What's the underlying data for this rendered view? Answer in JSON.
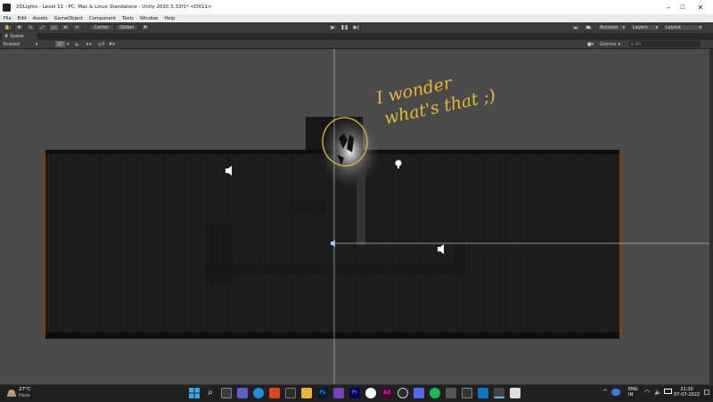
{
  "window": {
    "title": "2DLights - Level 11 - PC, Mac & Linux Standalone - Unity 2020.3.33f1* <DX11>",
    "controls": [
      "–",
      "☐",
      "✕"
    ]
  },
  "menu": [
    "File",
    "Edit",
    "Assets",
    "GameObject",
    "Component",
    "Tools",
    "Window",
    "Help"
  ],
  "toolbar": {
    "pivot_label": "Center",
    "space_label": "Global",
    "account_label": "Account",
    "layers_label": "Layers",
    "layout_label": "Layout"
  },
  "scene": {
    "tab_label": "Scene",
    "shading_mode": "Shaded",
    "view_mode_label": "2D",
    "gizmos_label": "Gizmos",
    "search_placeholder": "All"
  },
  "annotation": {
    "line1": "I wonder",
    "line2": "what's that ;)",
    "color": "#e8b830"
  },
  "taskbar": {
    "weather_temp": "27°C",
    "weather_desc": "Haze",
    "lang_top": "ENG",
    "lang_bottom": "IN",
    "time": "21:20",
    "date": "07-07-2022"
  },
  "colors": {
    "accent_orange": "#b5651d",
    "viewport_bg": "#4a4a4a",
    "level_dark": "#181818"
  }
}
